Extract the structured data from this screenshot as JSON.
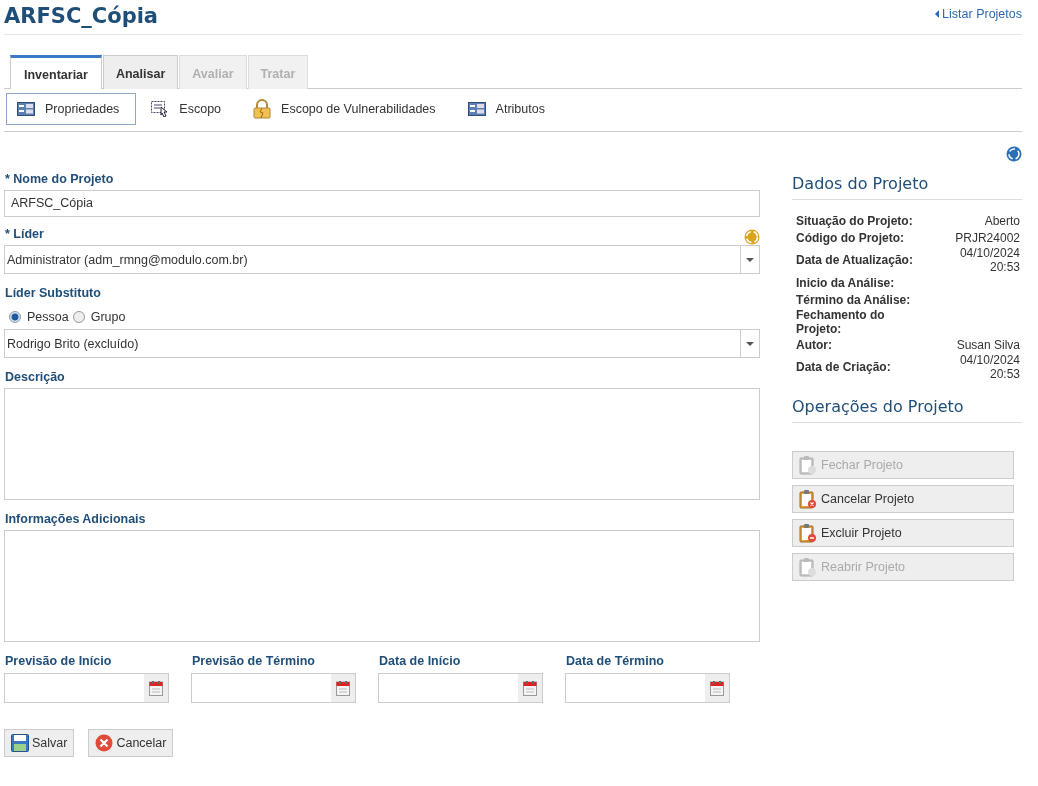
{
  "header": {
    "title": "ARFSC_Cópia",
    "back_link": "Listar Projetos"
  },
  "tabs": [
    {
      "label": "Inventariar",
      "selected": true,
      "disabled": false
    },
    {
      "label": "Analisar",
      "selected": false,
      "disabled": false
    },
    {
      "label": "Avaliar",
      "selected": false,
      "disabled": true
    },
    {
      "label": "Tratar",
      "selected": false,
      "disabled": true
    }
  ],
  "subtabs": [
    {
      "label": "Propriedades",
      "selected": true,
      "kind": "form"
    },
    {
      "label": "Escopo",
      "selected": false,
      "kind": "select"
    },
    {
      "label": "Escopo de Vulnerabilidades",
      "selected": false,
      "kind": "lock"
    },
    {
      "label": "Atributos",
      "selected": false,
      "kind": "form"
    }
  ],
  "form": {
    "name": {
      "label": "* Nome do Projeto",
      "value": "ARFSC_Cópia"
    },
    "leader": {
      "label": "* Líder",
      "value": "Administrator (adm_rmng@modulo.com.br)"
    },
    "substitute": {
      "label": "Líder Substituto",
      "options": [
        {
          "label": "Pessoa",
          "selected": true
        },
        {
          "label": "Grupo",
          "selected": false
        }
      ],
      "value": "Rodrigo Brito (excluído)"
    },
    "description": {
      "label": "Descrição"
    },
    "additional_info": {
      "label": "Informações Adicionais"
    },
    "dates": [
      {
        "label": "Previsão de Início"
      },
      {
        "label": "Previsão de Término"
      },
      {
        "label": "Data de Início"
      },
      {
        "label": "Data de Término"
      }
    ],
    "buttons": [
      {
        "label": "Salvar",
        "kind": "save"
      },
      {
        "label": "Cancelar",
        "kind": "cancel"
      }
    ]
  },
  "sidebar": {
    "data_title": "Dados do Projeto",
    "data": [
      {
        "label": "Situação do Projeto:",
        "value": "Aberto"
      },
      {
        "label": "Código do Projeto:",
        "value": "PRJR24002"
      },
      {
        "label": "Data de Atualização:",
        "value": "04/10/2024 20:53"
      },
      {
        "label": "Inicio da Análise:"
      },
      {
        "label": "Término da Análise:"
      },
      {
        "label": "Fechamento do Projeto:"
      },
      {
        "label": "Autor:",
        "value": "Susan Silva"
      },
      {
        "label": "Data de Criação:",
        "value": "04/10/2024 20:53"
      }
    ],
    "ops_title": "Operações do Projeto",
    "operations": [
      {
        "label": "Fechar Projeto",
        "disabled": true,
        "kind": "close"
      },
      {
        "label": "Cancelar Projeto",
        "disabled": false,
        "kind": "cancel"
      },
      {
        "label": "Excluir Projeto",
        "disabled": false,
        "kind": "delete"
      },
      {
        "label": "Reabrir Projeto",
        "disabled": true,
        "kind": "reopen"
      }
    ]
  }
}
